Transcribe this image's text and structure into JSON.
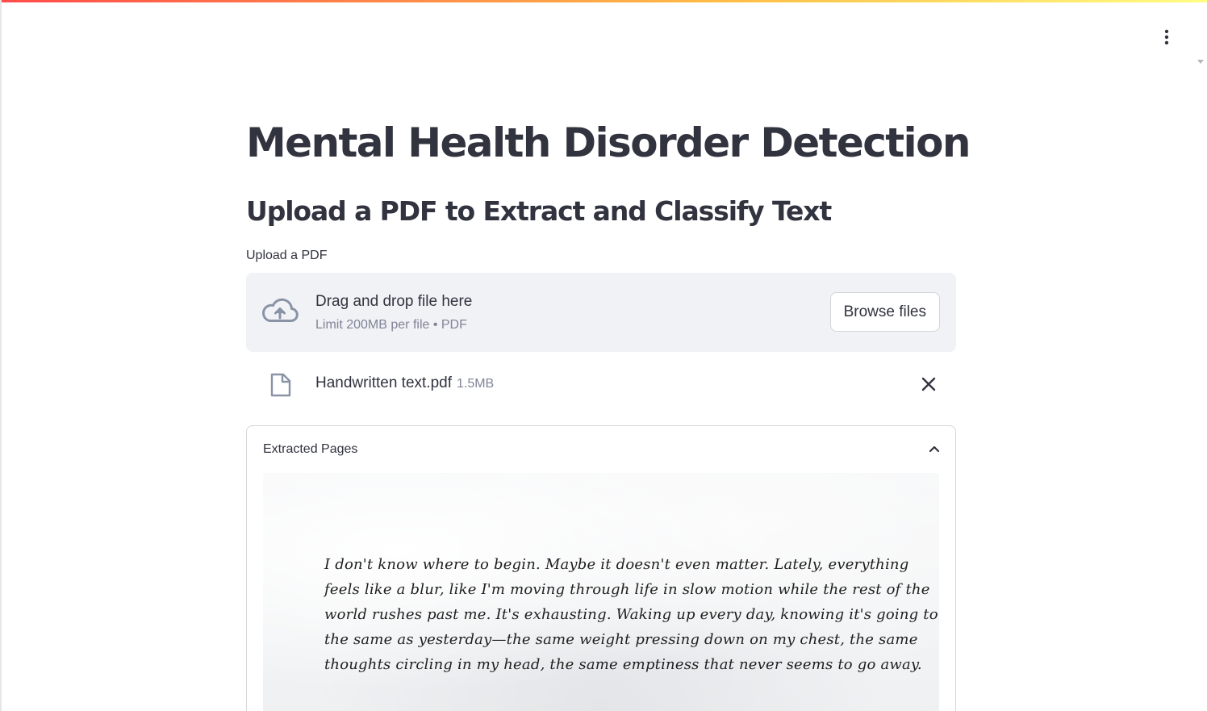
{
  "header": {
    "menu_icon": "kebab-menu-icon"
  },
  "main": {
    "title": "Mental Health Disorder Detection",
    "subtitle": "Upload a PDF to Extract and Classify Text",
    "uploader": {
      "label": "Upload a PDF",
      "dropzone_text": "Drag and drop file here",
      "limit_text": "Limit 200MB per file • PDF",
      "browse_label": "Browse files",
      "icon": "cloud-upload-icon"
    },
    "uploaded_file": {
      "name": "Handwritten text.pdf",
      "size": "1.5MB",
      "icon": "file-icon",
      "remove_icon": "close-icon"
    },
    "expander": {
      "title": "Extracted Pages",
      "expanded": true,
      "page_lines": [
        "I don't know where to begin. Maybe it doesn't even matter. Lately, everything",
        "feels like a blur, like I'm moving through life in slow motion while the rest of the",
        "world rushes past me. It's exhausting. Waking up every day, knowing it's going to be",
        "the same as yesterday—the same weight pressing down on my chest, the same",
        "thoughts circling in my head, the same emptiness that never seems to go away."
      ]
    }
  },
  "colors": {
    "text": "#31333f",
    "muted": "#808495",
    "dropzone_bg": "#f0f2f6",
    "icon": "#8a93a6"
  }
}
